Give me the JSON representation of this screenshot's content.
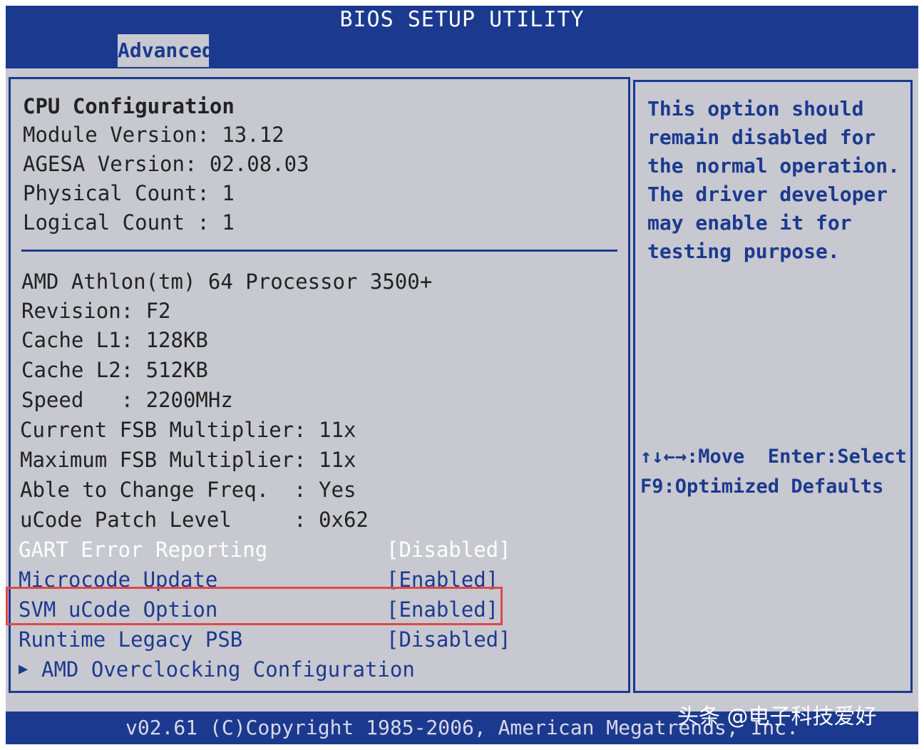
{
  "title": "BIOS SETUP UTILITY",
  "tabs": [
    {
      "label": "Advanced"
    }
  ],
  "section": {
    "heading": "CPU Configuration",
    "module_version": "Module Version: 13.12",
    "agesa_version": "AGESA Version: 02.08.03",
    "physical_count": "Physical Count: 1",
    "logical_count": "Logical Count : 1"
  },
  "cpu_info": {
    "model": "AMD Athlon(tm) 64 Processor 3500+",
    "revision": "Revision: F2",
    "cache_l1": "Cache L1: 128KB",
    "cache_l2": "Cache L2: 512KB",
    "speed": "Speed   : 2200MHz",
    "current_fsb": "Current FSB Multiplier: 11x",
    "max_fsb": "Maximum FSB Multiplier: 11x",
    "change_freq": "Able to Change Freq.  : Yes",
    "ucode_patch": "uCode Patch Level     : 0x62"
  },
  "options": [
    {
      "label": "GART Error Reporting",
      "value": "[Disabled]"
    },
    {
      "label": "Microcode Update",
      "value": "[Enabled]"
    },
    {
      "label": "SVM uCode Option",
      "value": "[Enabled]"
    },
    {
      "label": "Runtime Legacy PSB",
      "value": "[Disabled]"
    }
  ],
  "submenu": {
    "label": "AMD Overclocking Configuration",
    "icon": "triangle-right-icon"
  },
  "help": {
    "lines": [
      "This option should",
      "remain disabled for",
      "the normal operation.",
      "The driver developer",
      "may enable it for",
      "testing purpose."
    ],
    "keys": [
      "↑↓←→:Move  Enter:Select",
      "F9:Optimized Defaults"
    ]
  },
  "footer": "v02.61 (C)Copyright 1985-2006, American Megatrends, Inc.",
  "watermark": "头条 @电子科技爱好",
  "colors": {
    "accent": "#1b3a8f",
    "background": "#c8c8d0",
    "highlight": "#e04848"
  }
}
